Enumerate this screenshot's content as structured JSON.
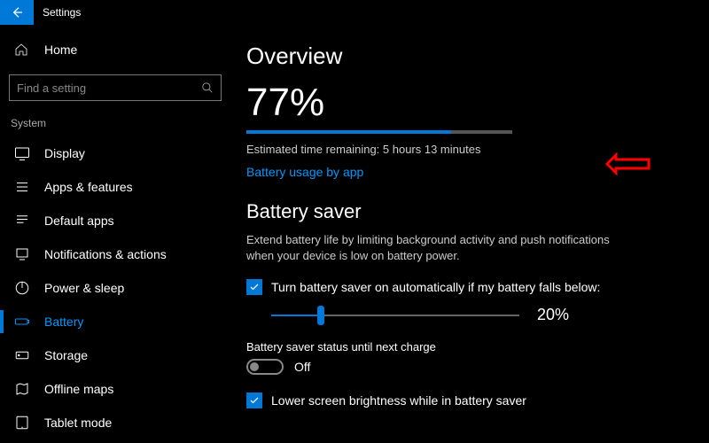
{
  "window": {
    "title": "Settings"
  },
  "sidebar": {
    "home": "Home",
    "search_placeholder": "Find a setting",
    "group": "System",
    "items": [
      {
        "label": "Display"
      },
      {
        "label": "Apps & features"
      },
      {
        "label": "Default apps"
      },
      {
        "label": "Notifications & actions"
      },
      {
        "label": "Power & sleep"
      },
      {
        "label": "Battery"
      },
      {
        "label": "Storage"
      },
      {
        "label": "Offline maps"
      },
      {
        "label": "Tablet mode"
      }
    ]
  },
  "overview": {
    "heading": "Overview",
    "percent": "77%",
    "percent_num": 77,
    "estimated": "Estimated time remaining: 5 hours 13 minutes",
    "link": "Battery usage by app"
  },
  "saver": {
    "heading": "Battery saver",
    "desc": "Extend battery life by limiting background activity and push notifications when your device is low on battery power.",
    "auto_label": "Turn battery saver on automatically if my battery falls below:",
    "threshold": 20,
    "threshold_text": "20%",
    "status_label": "Battery saver status until next charge",
    "toggle_state": "Off",
    "lower_brightness": "Lower screen brightness while in battery saver"
  }
}
